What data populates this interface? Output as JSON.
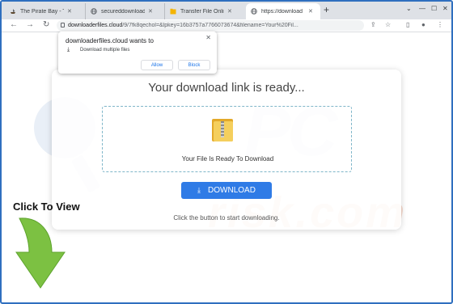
{
  "tabs": [
    {
      "label": "The Pirate Bay - T",
      "icon": "pirate-ship-icon"
    },
    {
      "label": "secureddownloads",
      "icon": "globe-icon"
    },
    {
      "label": "Transfer File Onlin",
      "icon": "folder-icon"
    },
    {
      "label": "https://download",
      "icon": "globe-icon"
    }
  ],
  "address": {
    "host": "downloaderfiles.cloud",
    "path": "/9/7fk8qechol=&lpkey=16b3757a7766073674&filename=Your%20Fil..."
  },
  "popup": {
    "title": "downloaderfiles.cloud wants to",
    "permission": "Download multiple files",
    "allow": "Allow",
    "block": "Block"
  },
  "card": {
    "title": "Your download link is ready...",
    "ready_text": "Your File Is Ready To Download",
    "button": "DOWNLOAD",
    "hint": "Click the button to start downloading."
  },
  "overlay": {
    "click_label": "Click To View"
  },
  "colors": {
    "accent": "#2f7be6",
    "arrow": "#7cc142",
    "frame": "#2f6fbf"
  }
}
